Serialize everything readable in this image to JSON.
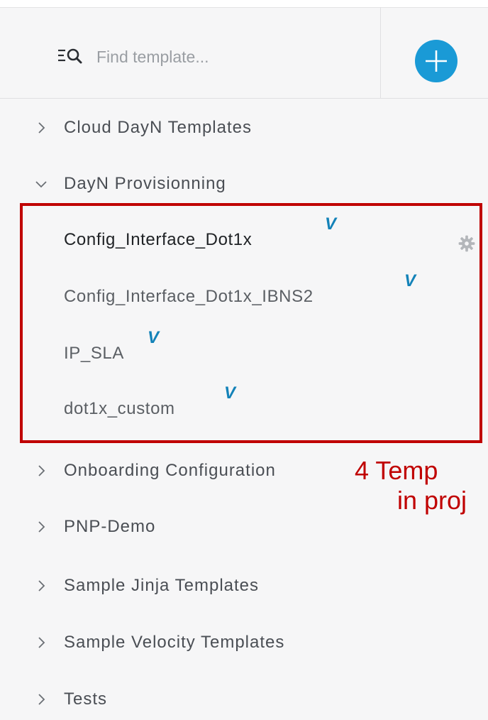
{
  "search": {
    "placeholder": "Find template..."
  },
  "tree": {
    "projects": [
      {
        "label": "Cloud DayN Templates",
        "expanded": false
      },
      {
        "label": "DayN Provisionning",
        "expanded": true
      },
      {
        "label": "Onboarding Configuration",
        "expanded": false
      },
      {
        "label": "PNP-Demo",
        "expanded": false
      },
      {
        "label": "Sample Jinja Templates",
        "expanded": false
      },
      {
        "label": "Sample Velocity Templates",
        "expanded": false
      },
      {
        "label": "Tests",
        "expanded": false
      }
    ],
    "templates": [
      {
        "label": "Config_Interface_Dot1x",
        "badge": "V",
        "active": true
      },
      {
        "label": "Config_Interface_Dot1x_IBNS2",
        "badge": "V"
      },
      {
        "label": "IP_SLA",
        "badge": "V"
      },
      {
        "label": "dot1x_custom",
        "badge": "V"
      }
    ]
  },
  "annotation": {
    "line1": "4 Temp",
    "line2": "in proj"
  },
  "colors": {
    "accent": "#1a9ad6",
    "annotation": "#c00000",
    "badge": "#1382b8"
  },
  "icons": {
    "search": "filter-search-icon",
    "add": "plus-circle-icon",
    "settings": "gear-icon"
  }
}
